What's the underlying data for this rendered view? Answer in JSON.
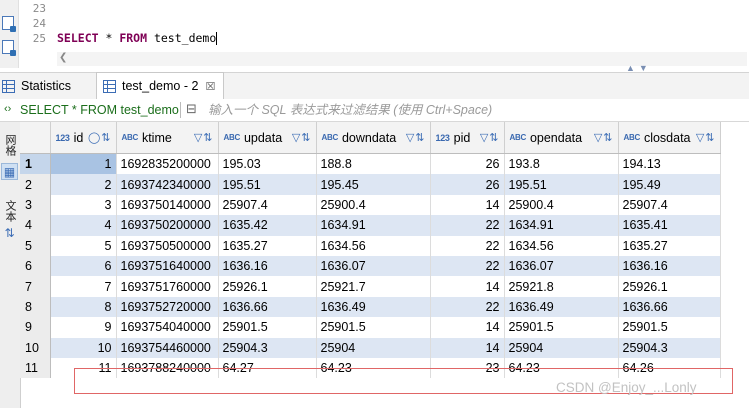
{
  "editor": {
    "line_numbers": [
      "23",
      "24",
      "25"
    ],
    "sql_keyword_select": "SELECT",
    "sql_star": " * ",
    "sql_keyword_from": "FROM",
    "sql_table": " test_demo"
  },
  "tabs": [
    {
      "label": "Statistics",
      "icon": "table-icon",
      "active": false
    },
    {
      "label": "test_demo - 2",
      "icon": "table-icon",
      "active": true,
      "close": "☒"
    }
  ],
  "filter": {
    "query": "SELECT * FROM test_demo",
    "placeholder": "输入一个 SQL 表达式来过滤结果 (使用 Ctrl+Space)"
  },
  "sidebar": {
    "grid_label": "网格",
    "text_label": "文本"
  },
  "grid": {
    "columns": [
      {
        "name": "id",
        "type": "123"
      },
      {
        "name": "ktime",
        "type": "ABC"
      },
      {
        "name": "updata",
        "type": "ABC"
      },
      {
        "name": "downdata",
        "type": "ABC"
      },
      {
        "name": "pid",
        "type": "123"
      },
      {
        "name": "opendata",
        "type": "ABC"
      },
      {
        "name": "closdata",
        "type": "ABC"
      }
    ],
    "rows": [
      [
        "1",
        "1",
        "1692835200000",
        "195.03",
        "188.8",
        "26",
        "193.8",
        "194.13"
      ],
      [
        "2",
        "2",
        "1693742340000",
        "195.51",
        "195.45",
        "26",
        "195.51",
        "195.49"
      ],
      [
        "3",
        "3",
        "1693750140000",
        "25907.4",
        "25900.4",
        "14",
        "25900.4",
        "25907.4"
      ],
      [
        "4",
        "4",
        "1693750200000",
        "1635.42",
        "1634.91",
        "22",
        "1634.91",
        "1635.41"
      ],
      [
        "5",
        "5",
        "1693750500000",
        "1635.27",
        "1634.56",
        "22",
        "1634.56",
        "1635.27"
      ],
      [
        "6",
        "6",
        "1693751640000",
        "1636.16",
        "1636.07",
        "22",
        "1636.07",
        "1636.16"
      ],
      [
        "7",
        "7",
        "1693751760000",
        "25926.1",
        "25921.7",
        "14",
        "25921.8",
        "25926.1"
      ],
      [
        "8",
        "8",
        "1693752720000",
        "1636.66",
        "1636.49",
        "22",
        "1636.49",
        "1636.66"
      ],
      [
        "9",
        "9",
        "1693754040000",
        "25901.5",
        "25901.5",
        "14",
        "25901.5",
        "25901.5"
      ],
      [
        "10",
        "10",
        "1693754460000",
        "25904.3",
        "25904",
        "14",
        "25904",
        "25904.3"
      ],
      [
        "11",
        "11",
        "1693788240000",
        "64.27",
        "64.23",
        "23",
        "64.23",
        "64.26"
      ]
    ]
  },
  "watermark": "CSDN @Enjoy_...Lonly",
  "colors": {
    "keyword": "#7f0055",
    "filter_query": "#1b6e1b",
    "row_alt": "#dde6f3",
    "highlight_box": "#e06666"
  }
}
